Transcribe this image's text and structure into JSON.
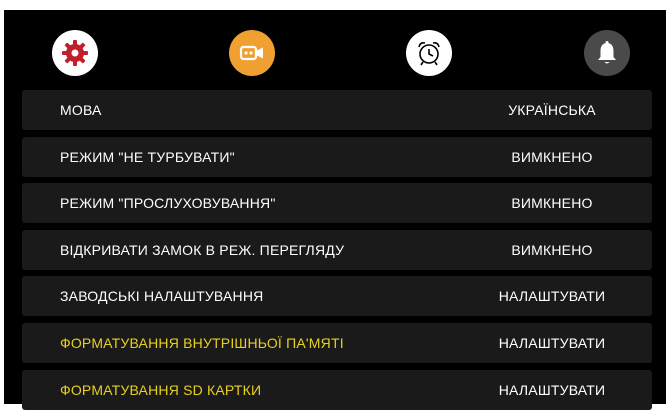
{
  "toolbar": {
    "icons": [
      "gear-icon",
      "video-camera-icon",
      "alarm-clock-icon",
      "bell-icon"
    ],
    "colors": {
      "settings_bg": "#ffffff",
      "settings_icon": "#c0202a",
      "video_bg": "#f0a030",
      "alarm_bg": "#ffffff",
      "bell_bg": "#4a4a4a"
    }
  },
  "menu": {
    "items": [
      {
        "label": "МОВА",
        "value": "УКРАЇНСЬКА"
      },
      {
        "label": "РЕЖИМ \"НЕ ТУРБУВАТИ\"",
        "value": "ВИМКНЕНО"
      },
      {
        "label": "РЕЖИМ \"ПРОСЛУХОВУВАННЯ\"",
        "value": "ВИМКНЕНО"
      },
      {
        "label": "ВІДКРИВАТИ ЗАМОК В РЕЖ. ПЕРЕГЛЯДУ",
        "value": "ВИМКНЕНО"
      },
      {
        "label": "ЗАВОДСЬКІ НАЛАШТУВАННЯ",
        "value": "НАЛАШТУВАТИ"
      },
      {
        "label": "ФОРМАТУВАННЯ ВНУТРІШНЬОЇ ПА'МЯТІ",
        "value": "НАЛАШТУВАТИ"
      },
      {
        "label": "ФОРМАТУВАННЯ SD КАРТКИ",
        "value": "НАЛАШТУВАТИ"
      }
    ],
    "highlight_color": "#e8d020"
  }
}
